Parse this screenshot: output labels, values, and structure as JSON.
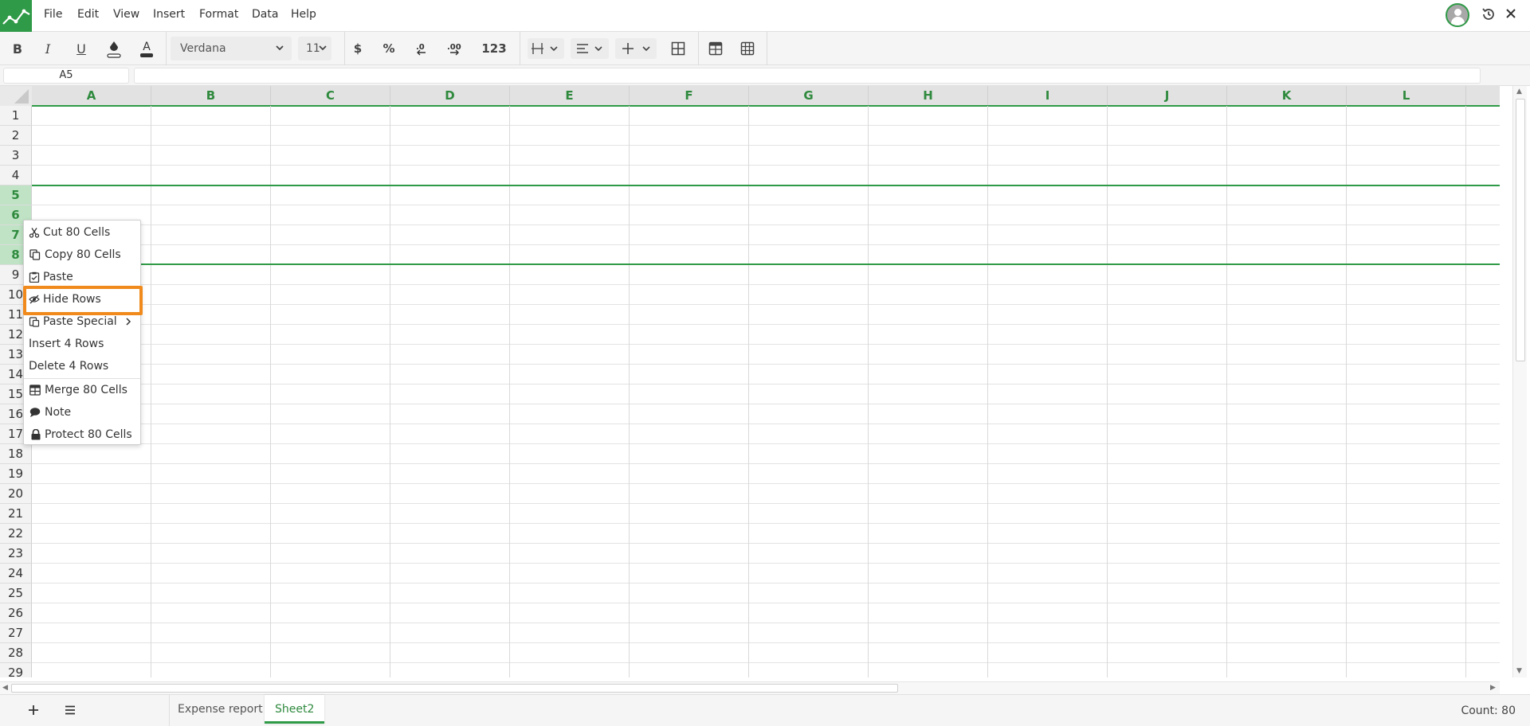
{
  "app": {
    "accent_color": "#2f9a47",
    "highlight_color": "#f08a1c"
  },
  "menu": {
    "items": [
      {
        "label": "File"
      },
      {
        "label": "Edit"
      },
      {
        "label": "View"
      },
      {
        "label": "Insert"
      },
      {
        "label": "Format"
      },
      {
        "label": "Data"
      },
      {
        "label": "Help"
      }
    ],
    "right_icons": [
      "avatar",
      "history-icon",
      "close-icon"
    ]
  },
  "toolbar": {
    "bold": "B",
    "italic": "I",
    "underline": "U",
    "font_family": "Verdana",
    "font_size": "11",
    "currency": "$",
    "percent": "%",
    "number_format": "123"
  },
  "formula_bar": {
    "cell_ref": "A5",
    "formula": ""
  },
  "grid": {
    "columns": [
      "A",
      "B",
      "C",
      "D",
      "E",
      "F",
      "G",
      "H",
      "I",
      "J",
      "K",
      "L"
    ],
    "rows": [
      "1",
      "2",
      "3",
      "4",
      "5",
      "6",
      "7",
      "8",
      "9",
      "10",
      "11",
      "12",
      "13",
      "14",
      "15",
      "16",
      "17",
      "18",
      "19",
      "20",
      "21",
      "22",
      "23",
      "24",
      "25",
      "26",
      "27",
      "28",
      "29"
    ],
    "selected_rows": [
      "5",
      "6",
      "7",
      "8"
    ]
  },
  "context_menu": {
    "items": [
      {
        "label": "Cut 80 Cells",
        "icon": "scissors-icon"
      },
      {
        "label": "Copy 80 Cells",
        "icon": "copy-icon"
      },
      {
        "label": "Paste",
        "icon": "clipboard-icon"
      },
      {
        "label": "Hide Rows",
        "icon": "eye-slash-icon"
      },
      {
        "label": "Paste Special",
        "icon": "paste-special-icon"
      },
      {
        "label": "Insert 4 Rows",
        "icon": ""
      },
      {
        "label": "Delete 4 Rows",
        "icon": ""
      },
      {
        "label": "Merge 80 Cells",
        "icon": "table-icon"
      },
      {
        "label": "Note",
        "icon": "comment-icon"
      },
      {
        "label": "Protect 80 Cells",
        "icon": "lock-icon"
      }
    ]
  },
  "sheets": {
    "tabs": [
      {
        "label": "Expense report"
      },
      {
        "label": "Sheet2"
      }
    ],
    "active": "Sheet2"
  },
  "status": {
    "count": "Count: 80"
  }
}
